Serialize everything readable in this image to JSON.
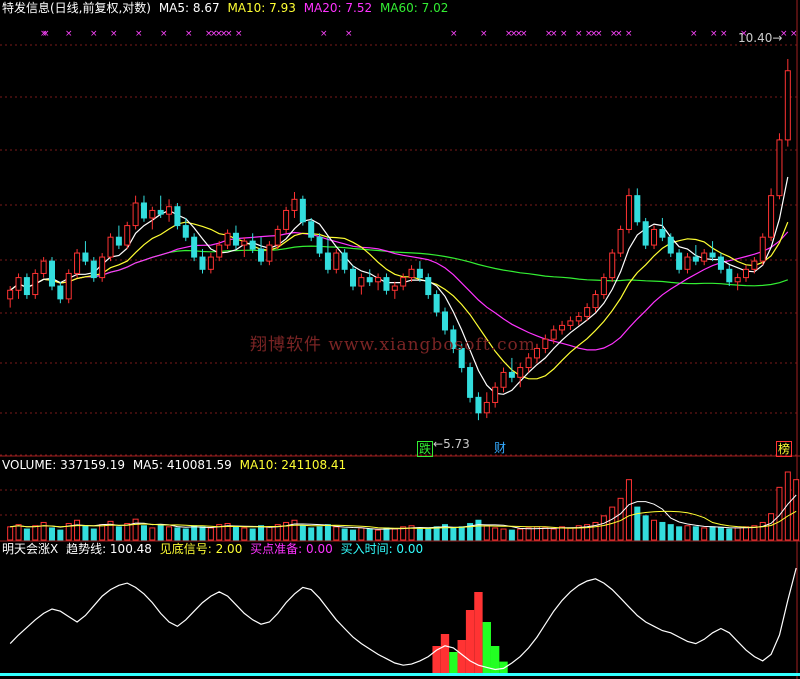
{
  "colors": {
    "up": "#ff3333",
    "down": "#33dddd",
    "ma5": "#ffffff",
    "ma10": "#ffff33",
    "ma20": "#ff33ff",
    "ma60": "#33ee33",
    "grid": "#7a1a1a",
    "axis": "#a02020",
    "xmark": "#ff44ff",
    "bar_green": "#22ff22",
    "bar_cyan": "#33ffff"
  },
  "header": {
    "title": "特发信息(日线,前复权,对数)",
    "ma5": "MA5: 8.67",
    "ma10": "MA10: 7.93",
    "ma20": "MA20: 7.52",
    "ma60": "MA60: 7.02"
  },
  "volume_header": {
    "volume": "VOLUME: 337159.19",
    "ma5": "MA5: 410081.59",
    "ma10": "MA10: 241108.41"
  },
  "indicator_header": {
    "name": "明天会涨X",
    "trend": "趋势线: 100.48",
    "bottom_signal": "见底信号: 2.00",
    "buy_prep": "买点准备: 0.00",
    "buy_time": "买入时间: 0.00"
  },
  "annotations": {
    "low_price": "5.73",
    "high_price": "10.40",
    "badge_die": "跌",
    "badge_cai": "财",
    "badge_bang": "榜"
  },
  "watermark": "翔博软件 www.xiangbosoft.com",
  "chart_data": {
    "type": "candlestick",
    "title": "特发信息(日线,前复权,对数)",
    "scale": "log",
    "price_max_marked": 10.4,
    "price_min_marked": 5.73,
    "price_ylim": [
      5.5,
      11.0
    ],
    "moving_averages": [
      {
        "name": "MA5",
        "value": 8.67
      },
      {
        "name": "MA10",
        "value": 7.93
      },
      {
        "name": "MA20",
        "value": 7.52
      },
      {
        "name": "MA60",
        "value": 7.02
      }
    ],
    "candles_ohlc": [
      [
        7.0,
        7.15,
        6.9,
        7.1
      ],
      [
        7.1,
        7.3,
        7.0,
        7.25
      ],
      [
        7.25,
        7.3,
        7.0,
        7.05
      ],
      [
        7.05,
        7.35,
        7.0,
        7.3
      ],
      [
        7.3,
        7.5,
        7.25,
        7.45
      ],
      [
        7.45,
        7.5,
        7.1,
        7.15
      ],
      [
        7.15,
        7.2,
        6.95,
        7.0
      ],
      [
        7.0,
        7.35,
        6.95,
        7.3
      ],
      [
        7.3,
        7.6,
        7.25,
        7.55
      ],
      [
        7.55,
        7.7,
        7.4,
        7.45
      ],
      [
        7.45,
        7.5,
        7.2,
        7.25
      ],
      [
        7.25,
        7.55,
        7.2,
        7.5
      ],
      [
        7.5,
        7.8,
        7.45,
        7.75
      ],
      [
        7.75,
        7.9,
        7.6,
        7.65
      ],
      [
        7.65,
        7.95,
        7.6,
        7.9
      ],
      [
        7.9,
        8.3,
        7.85,
        8.2
      ],
      [
        8.2,
        8.3,
        7.95,
        8.0
      ],
      [
        8.0,
        8.15,
        7.85,
        8.1
      ],
      [
        8.1,
        8.3,
        8.0,
        8.05
      ],
      [
        8.05,
        8.25,
        7.95,
        8.15
      ],
      [
        8.15,
        8.2,
        7.85,
        7.9
      ],
      [
        7.9,
        8.0,
        7.7,
        7.75
      ],
      [
        7.75,
        7.8,
        7.45,
        7.5
      ],
      [
        7.5,
        7.6,
        7.3,
        7.35
      ],
      [
        7.35,
        7.55,
        7.3,
        7.5
      ],
      [
        7.5,
        7.7,
        7.45,
        7.65
      ],
      [
        7.65,
        7.85,
        7.6,
        7.8
      ],
      [
        7.8,
        7.9,
        7.6,
        7.65
      ],
      [
        7.65,
        7.75,
        7.5,
        7.7
      ],
      [
        7.7,
        7.8,
        7.55,
        7.6
      ],
      [
        7.6,
        7.75,
        7.4,
        7.45
      ],
      [
        7.45,
        7.7,
        7.4,
        7.65
      ],
      [
        7.65,
        7.9,
        7.6,
        7.85
      ],
      [
        7.85,
        8.15,
        7.8,
        8.1
      ],
      [
        8.1,
        8.35,
        8.0,
        8.25
      ],
      [
        8.25,
        8.3,
        7.9,
        7.95
      ],
      [
        7.95,
        8.0,
        7.7,
        7.75
      ],
      [
        7.75,
        7.8,
        7.5,
        7.55
      ],
      [
        7.55,
        7.75,
        7.3,
        7.35
      ],
      [
        7.35,
        7.6,
        7.3,
        7.55
      ],
      [
        7.55,
        7.6,
        7.3,
        7.35
      ],
      [
        7.35,
        7.4,
        7.1,
        7.15
      ],
      [
        7.15,
        7.3,
        7.05,
        7.25
      ],
      [
        7.25,
        7.35,
        7.15,
        7.2
      ],
      [
        7.2,
        7.3,
        7.1,
        7.25
      ],
      [
        7.25,
        7.3,
        7.05,
        7.1
      ],
      [
        7.1,
        7.2,
        7.0,
        7.15
      ],
      [
        7.15,
        7.3,
        7.1,
        7.25
      ],
      [
        7.25,
        7.4,
        7.2,
        7.35
      ],
      [
        7.35,
        7.45,
        7.2,
        7.25
      ],
      [
        7.25,
        7.3,
        7.0,
        7.05
      ],
      [
        7.05,
        7.1,
        6.8,
        6.85
      ],
      [
        6.85,
        6.9,
        6.6,
        6.65
      ],
      [
        6.65,
        6.7,
        6.4,
        6.45
      ],
      [
        6.45,
        6.5,
        6.2,
        6.25
      ],
      [
        6.25,
        6.3,
        5.9,
        5.95
      ],
      [
        5.95,
        6.0,
        5.73,
        5.8
      ],
      [
        5.8,
        6.0,
        5.75,
        5.9
      ],
      [
        5.9,
        6.1,
        5.85,
        6.05
      ],
      [
        6.05,
        6.25,
        6.0,
        6.2
      ],
      [
        6.2,
        6.35,
        6.1,
        6.15
      ],
      [
        6.15,
        6.3,
        6.05,
        6.25
      ],
      [
        6.25,
        6.4,
        6.2,
        6.35
      ],
      [
        6.35,
        6.5,
        6.3,
        6.45
      ],
      [
        6.45,
        6.6,
        6.4,
        6.55
      ],
      [
        6.55,
        6.7,
        6.5,
        6.65
      ],
      [
        6.65,
        6.75,
        6.6,
        6.7
      ],
      [
        6.7,
        6.8,
        6.65,
        6.75
      ],
      [
        6.75,
        6.85,
        6.7,
        6.8
      ],
      [
        6.8,
        6.95,
        6.75,
        6.9
      ],
      [
        6.9,
        7.1,
        6.85,
        7.05
      ],
      [
        7.05,
        7.3,
        7.0,
        7.25
      ],
      [
        7.25,
        7.6,
        7.2,
        7.55
      ],
      [
        7.55,
        7.9,
        7.5,
        7.85
      ],
      [
        7.85,
        8.4,
        7.8,
        8.3
      ],
      [
        8.3,
        8.4,
        7.9,
        7.95
      ],
      [
        7.95,
        8.0,
        7.6,
        7.65
      ],
      [
        7.65,
        7.9,
        7.6,
        7.85
      ],
      [
        7.85,
        8.0,
        7.7,
        7.75
      ],
      [
        7.75,
        7.8,
        7.5,
        7.55
      ],
      [
        7.55,
        7.6,
        7.3,
        7.35
      ],
      [
        7.35,
        7.55,
        7.3,
        7.5
      ],
      [
        7.5,
        7.65,
        7.4,
        7.45
      ],
      [
        7.45,
        7.6,
        7.4,
        7.55
      ],
      [
        7.55,
        7.7,
        7.45,
        7.5
      ],
      [
        7.5,
        7.55,
        7.3,
        7.35
      ],
      [
        7.35,
        7.4,
        7.15,
        7.2
      ],
      [
        7.2,
        7.3,
        7.1,
        7.25
      ],
      [
        7.25,
        7.4,
        7.2,
        7.35
      ],
      [
        7.35,
        7.5,
        7.3,
        7.45
      ],
      [
        7.45,
        7.8,
        7.4,
        7.75
      ],
      [
        7.75,
        8.4,
        7.7,
        8.3
      ],
      [
        8.3,
        9.2,
        8.25,
        9.1
      ],
      [
        9.1,
        10.4,
        9.0,
        10.2
      ]
    ],
    "volume": [
      12,
      14,
      10,
      13,
      16,
      11,
      9,
      15,
      18,
      13,
      10,
      14,
      17,
      12,
      15,
      19,
      13,
      11,
      14,
      12,
      11,
      10,
      13,
      12,
      11,
      14,
      15,
      12,
      11,
      10,
      13,
      12,
      14,
      16,
      18,
      13,
      11,
      12,
      14,
      12,
      10,
      9,
      11,
      10,
      9,
      11,
      10,
      12,
      13,
      11,
      10,
      12,
      14,
      11,
      12,
      15,
      18,
      13,
      11,
      10,
      9,
      10,
      11,
      12,
      11,
      10,
      12,
      11,
      13,
      14,
      16,
      22,
      30,
      38,
      55,
      30,
      22,
      18,
      16,
      14,
      12,
      13,
      12,
      11,
      12,
      11,
      10,
      11,
      12,
      13,
      16,
      24,
      48,
      62,
      55
    ],
    "indicator_trend": [
      30,
      38,
      45,
      52,
      58,
      62,
      60,
      55,
      50,
      56,
      65,
      74,
      80,
      84,
      86,
      82,
      76,
      68,
      58,
      50,
      46,
      52,
      60,
      68,
      74,
      78,
      74,
      66,
      58,
      52,
      48,
      50,
      58,
      68,
      76,
      82,
      80,
      72,
      62,
      52,
      44,
      36,
      30,
      25,
      20,
      16,
      12,
      10,
      11,
      14,
      18,
      24,
      28,
      26,
      20,
      14,
      10,
      8,
      6,
      7,
      12,
      18,
      26,
      36,
      48,
      60,
      70,
      78,
      84,
      88,
      90,
      86,
      80,
      72,
      64,
      56,
      50,
      46,
      42,
      40,
      36,
      32,
      30,
      34,
      40,
      44,
      40,
      32,
      24,
      18,
      14,
      20,
      38,
      70,
      100
    ]
  }
}
